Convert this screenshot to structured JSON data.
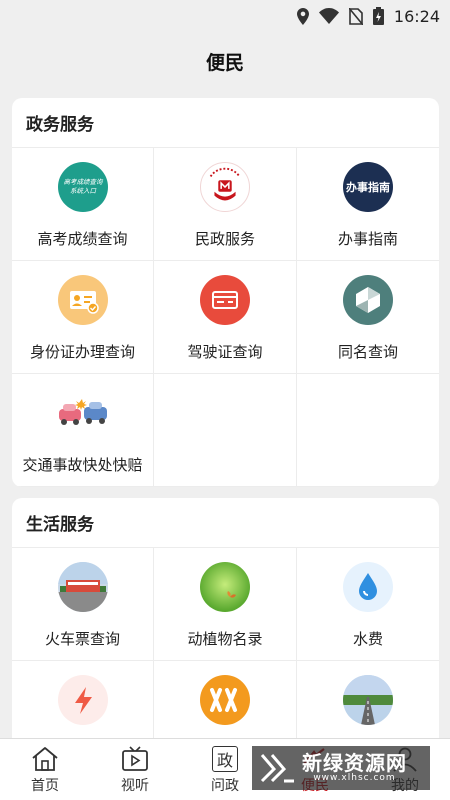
{
  "status_bar": {
    "time": "16:24"
  },
  "header": {
    "title": "便民"
  },
  "gov_services": {
    "title": "政务服务",
    "items": [
      {
        "label": "高考成绩查询",
        "icon": "exam-score-icon"
      },
      {
        "label": "民政服务",
        "icon": "civil-affairs-icon"
      },
      {
        "label": "办事指南",
        "icon": "service-guide-icon",
        "icon_text": "办事指南"
      },
      {
        "label": "身份证办理查询",
        "icon": "id-card-icon"
      },
      {
        "label": "驾驶证查询",
        "icon": "driver-license-icon"
      },
      {
        "label": "同名查询",
        "icon": "same-name-icon"
      },
      {
        "label": "交通事故快处快赔",
        "icon": "traffic-accident-icon"
      }
    ]
  },
  "life_services": {
    "title": "生活服务",
    "items": [
      {
        "label": "火车票查询",
        "icon": "train-station-icon"
      },
      {
        "label": "动植物名录",
        "icon": "plant-animal-icon"
      },
      {
        "label": "水费",
        "icon": "water-drop-icon"
      },
      {
        "label": "",
        "icon": "electricity-icon"
      },
      {
        "label": "",
        "icon": "gas-icon"
      },
      {
        "label": "",
        "icon": "road-icon"
      }
    ]
  },
  "tab_bar": {
    "tabs": [
      {
        "label": "首页",
        "icon": "home-icon"
      },
      {
        "label": "视听",
        "icon": "tv-icon"
      },
      {
        "label": "问政",
        "icon": "politics-icon",
        "icon_text": "政"
      },
      {
        "label": "便民",
        "icon": "convenience-icon"
      },
      {
        "label": "我的",
        "icon": "profile-icon"
      }
    ],
    "active": "便民"
  },
  "watermark": {
    "main": "新绿资源网",
    "sub": "www.xlhsc.com"
  },
  "colors": {
    "accent": "#c8161d",
    "teal": "#1e9e8c",
    "navy": "#1c2f52",
    "orange": "#f5a623",
    "red": "#e84b3c"
  }
}
